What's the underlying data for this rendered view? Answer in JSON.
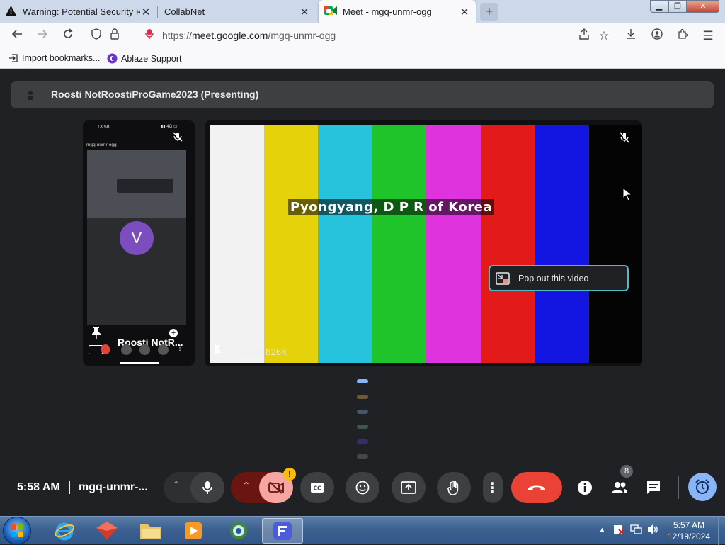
{
  "browser": {
    "tabs": [
      {
        "title": "Warning: Potential Security Risk",
        "icon": "warning-icon"
      },
      {
        "title": "CollabNet",
        "icon": "none"
      },
      {
        "title": "Meet - mgq-unmr-ogg",
        "icon": "meet-icon",
        "active": true
      }
    ],
    "url_scheme": "https://",
    "url_host": "meet.google.com",
    "url_path": "/mgq-unmr-ogg",
    "bookmarks": [
      {
        "label": "Import bookmarks...",
        "icon": "import-icon"
      },
      {
        "label": "Ablaze Support",
        "icon": "ablaze-icon"
      }
    ]
  },
  "meet": {
    "presenting_label": "Roosti NotRoostiProGame2023 (Presenting)",
    "tile_left": {
      "name": "Roosti NotR...",
      "phone_time": "13:58",
      "phone_meeting": "mgq-unmr-ogg",
      "avatar_letter": "V",
      "avatar_color": "#7c4dbe"
    },
    "tile_main": {
      "caption": "Pyongyang, D P R of Korea",
      "participant": "Guest 826K",
      "popout_label": "Pop out this video",
      "bar_colors": [
        "#f2f2f2",
        "#e6d20a",
        "#27c3dd",
        "#1fc32a",
        "#e033e0",
        "#e21a1a",
        "#1216e0",
        "#040404"
      ]
    },
    "controls": {
      "time": "5:58 AM",
      "meeting_code": "mgq-unmr-...",
      "people_count": "8",
      "camera_warning": "!"
    },
    "accent_red": "#ea4335",
    "camera_bg": "#f5a6a0"
  },
  "taskbar": {
    "clock_time": "5:57 AM",
    "clock_date": "12/19/2024"
  }
}
